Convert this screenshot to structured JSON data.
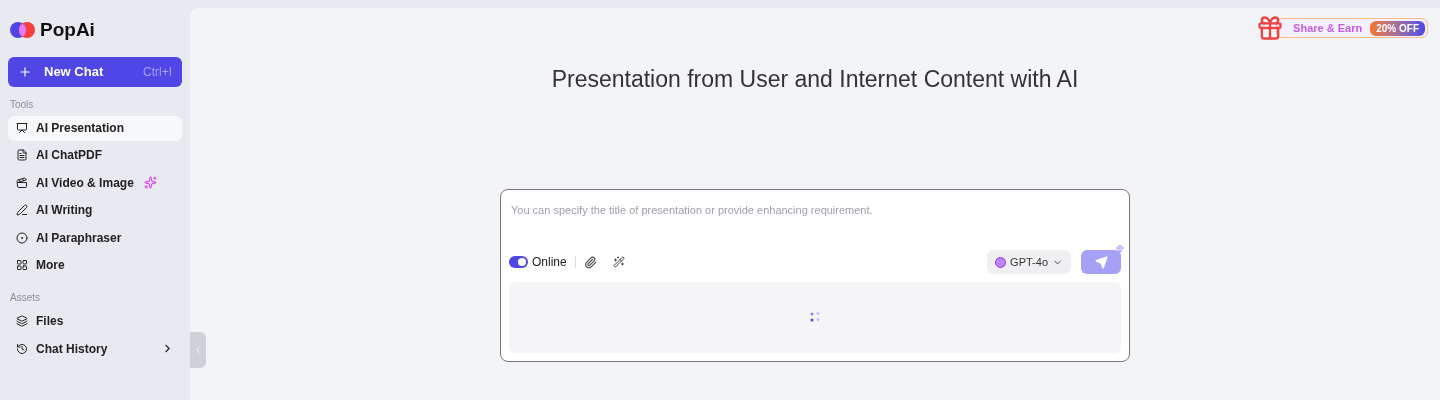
{
  "logo": {
    "text": "PopAi"
  },
  "new_chat": {
    "label": "New Chat",
    "shortcut": "Ctrl+I"
  },
  "sections": [
    {
      "heading": "Tools",
      "items": [
        {
          "label": "AI Presentation",
          "selected": true
        },
        {
          "label": "AI ChatPDF",
          "selected": false
        },
        {
          "label": "AI Video & Image",
          "selected": false,
          "sparkle": true
        },
        {
          "label": "AI Writing",
          "selected": false
        },
        {
          "label": "AI Paraphraser",
          "selected": false
        },
        {
          "label": "More",
          "selected": false
        }
      ]
    },
    {
      "heading": "Assets",
      "items": [
        {
          "label": "Files",
          "selected": false
        },
        {
          "label": "Chat History",
          "selected": false,
          "chevron": true
        }
      ]
    }
  ],
  "promo": {
    "label": "Share & Earn",
    "badge": "20% OFF"
  },
  "title": "Presentation from User and Internet Content with AI",
  "composer": {
    "placeholder": "You can specify the title of presentation or provide enhancing requirement.",
    "online": {
      "label": "Online",
      "on": true
    },
    "model": "GPT-4o"
  }
}
